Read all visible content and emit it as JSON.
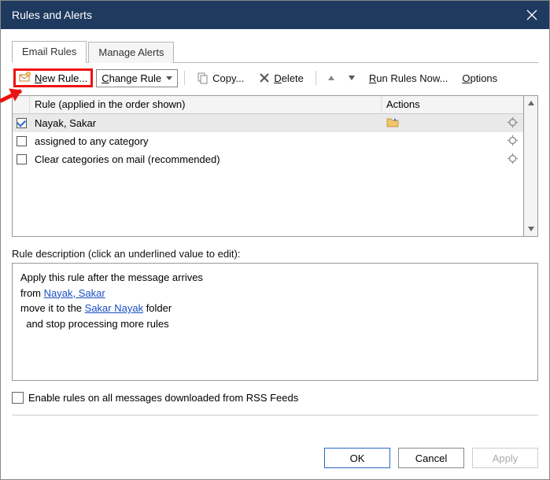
{
  "title": "Rules and Alerts",
  "tabs": {
    "email_rules": "Email Rules",
    "manage_alerts": "Manage Alerts"
  },
  "toolbar": {
    "new_rule": "New Rule...",
    "change_rule": "Change Rule",
    "copy": "Copy...",
    "delete": "Delete",
    "run_rules": "Run Rules Now...",
    "options": "Options"
  },
  "grid": {
    "header_rule": "Rule (applied in the order shown)",
    "header_actions": "Actions",
    "rows": [
      {
        "checked": true,
        "name": "Nayak, Sakar",
        "action_icon": "folder"
      },
      {
        "checked": false,
        "name": "assigned to any category",
        "action_icon": "gear"
      },
      {
        "checked": false,
        "name": "Clear categories on mail (recommended)",
        "action_icon": "gear"
      }
    ]
  },
  "description": {
    "label": "Rule description (click an underlined value to edit):",
    "line1": "Apply this rule after the message arrives",
    "from_prefix": "from ",
    "from_link": "Nayak, Sakar",
    "move_prefix": "move it to the ",
    "move_link": "Sakar Nayak",
    "move_suffix": " folder",
    "line4": "  and stop processing more rules"
  },
  "rss_checkbox_label": "Enable rules on all messages downloaded from RSS Feeds",
  "buttons": {
    "ok": "OK",
    "cancel": "Cancel",
    "apply": "Apply"
  }
}
